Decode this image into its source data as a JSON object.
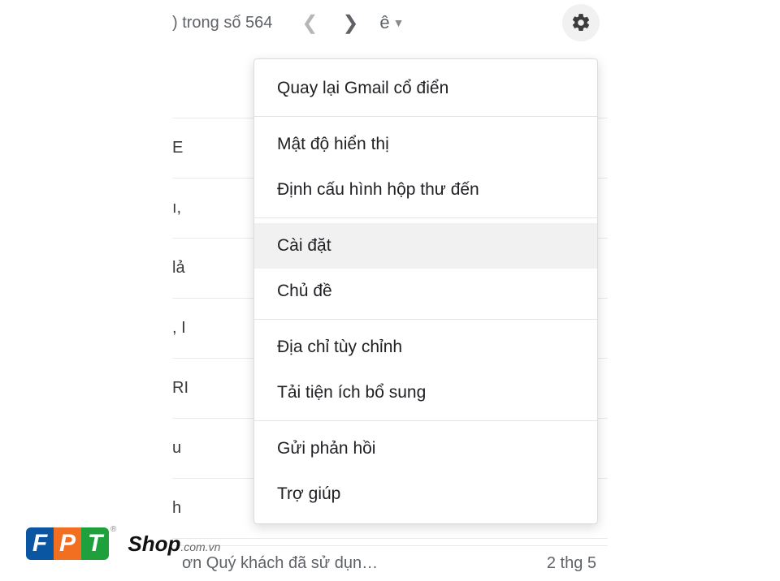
{
  "toolbar": {
    "counter_text": ") trong số 564",
    "lang_label": "ê"
  },
  "bg_rows": [
    {
      "frag": ""
    },
    {
      "frag": "E"
    },
    {
      "frag": "ı,"
    },
    {
      "frag": "lả"
    },
    {
      "frag": ", I"
    },
    {
      "frag": "RI"
    },
    {
      "frag": "u"
    },
    {
      "frag": "h"
    }
  ],
  "bottom_row": {
    "text": "ơn Quý khách đã sử dụn…",
    "date": "2 thg 5"
  },
  "menu": {
    "items": [
      {
        "label": "Quay lại Gmail cổ điển",
        "divider_after": true
      },
      {
        "label": "Mật độ hiển thị",
        "divider_after": false
      },
      {
        "label": "Định cấu hình hộp thư đến",
        "divider_after": true
      },
      {
        "label": "Cài đặt",
        "hover": true
      },
      {
        "label": "Chủ đề",
        "divider_after": true
      },
      {
        "label": "Địa chỉ tùy chỉnh"
      },
      {
        "label": "Tải tiện ích bổ sung",
        "divider_after": true
      },
      {
        "label": "Gửi phản hồi"
      },
      {
        "label": "Trợ giúp"
      }
    ]
  },
  "brand": {
    "f": "F",
    "p": "P",
    "t": "T",
    "shop": "Shop",
    "domain": ".com.vn",
    "reg": "®"
  }
}
